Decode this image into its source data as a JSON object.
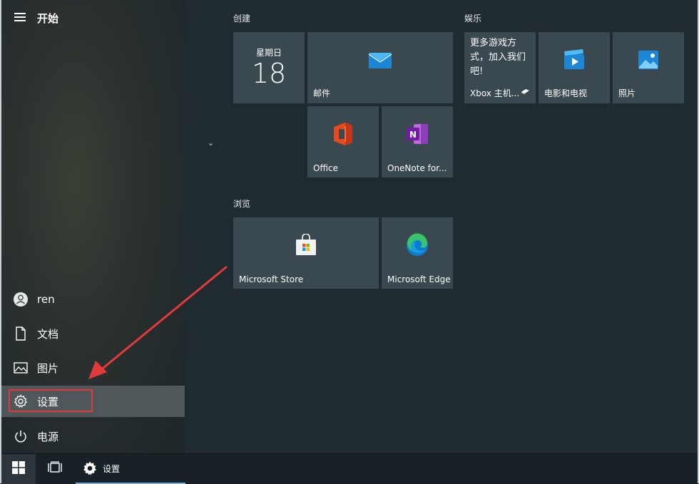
{
  "left_rail": {
    "title": "开始",
    "items": [
      {
        "id": "user",
        "label": "ren",
        "icon": "user-icon"
      },
      {
        "id": "docs",
        "label": "文档",
        "icon": "document-icon"
      },
      {
        "id": "pics",
        "label": "图片",
        "icon": "image-icon"
      },
      {
        "id": "settings",
        "label": "设置",
        "icon": "gear-icon",
        "selected": true
      },
      {
        "id": "power",
        "label": "电源",
        "icon": "power-icon"
      }
    ]
  },
  "groups": {
    "create": "创建",
    "entertainment": "娱乐",
    "browse": "浏览"
  },
  "tiles": {
    "calendar": {
      "weekday": "星期日",
      "day": "18"
    },
    "mail": {
      "label": "邮件"
    },
    "office": {
      "label": "Office"
    },
    "onenote": {
      "label": "OneNote for..."
    },
    "xbox": {
      "text": "更多游戏方式，加入我们吧!",
      "label": "Xbox 主机..."
    },
    "movies": {
      "label": "电影和电视"
    },
    "photos": {
      "label": "照片"
    },
    "store": {
      "label": "Microsoft Store"
    },
    "edge": {
      "label": "Microsoft Edge"
    }
  },
  "taskbar": {
    "app_label": "设置"
  },
  "colors": {
    "accent": "#79a8d4",
    "highlight_box": "#e23a3a",
    "arrow": "#e23a3a"
  }
}
